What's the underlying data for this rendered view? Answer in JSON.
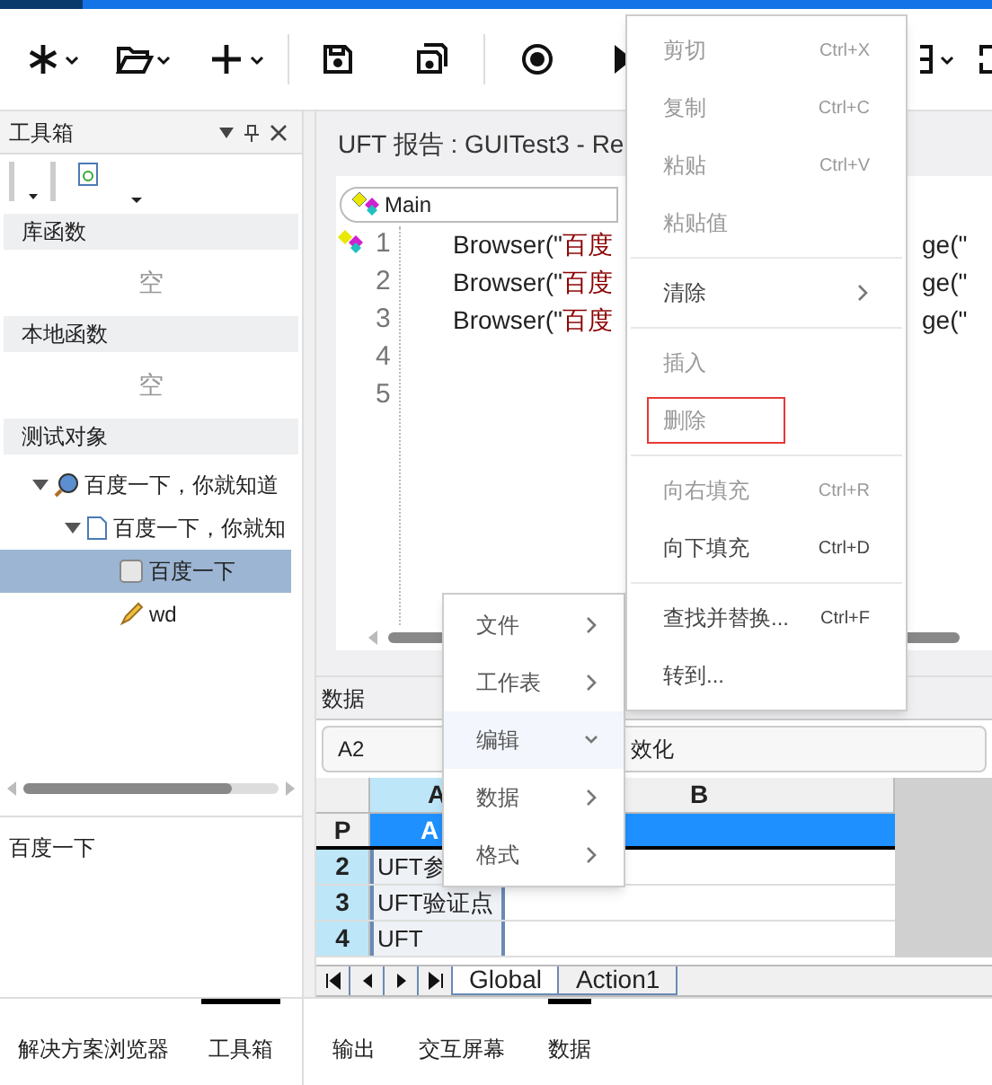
{
  "left_panel": {
    "title": "工具箱",
    "sections": [
      {
        "title": "库函数",
        "empty_text": "空"
      },
      {
        "title": "本地函数",
        "empty_text": "空"
      }
    ],
    "objects": {
      "title": "测试对象",
      "tree": [
        {
          "label": "百度一下，你就知道",
          "kind": "browser",
          "expanded": true,
          "selected": false,
          "children": [
            {
              "label": "百度一下，你就知",
              "kind": "page",
              "expanded": true,
              "selected": false,
              "children": [
                {
                  "label": "百度一下",
                  "kind": "button",
                  "selected": true
                },
                {
                  "label": "wd",
                  "kind": "edit",
                  "selected": false
                }
              ]
            }
          ]
        }
      ]
    },
    "description": "百度一下",
    "bottom_tabs": [
      {
        "label": "解决方案浏览器",
        "selected": false
      },
      {
        "label": "工具箱",
        "selected": true
      }
    ]
  },
  "editor": {
    "tab_title": "UFT 报告 : GUITest3 - Re",
    "scope": "Main",
    "lines": [
      {
        "number": "1",
        "code": "Browser(\"",
        "string": "百度",
        "code_2": "ge(\""
      },
      {
        "number": "2",
        "code": "Browser(\"",
        "string": "百度",
        "code_2": "ge(\""
      },
      {
        "number": "3",
        "code": "Browser(\"",
        "string": "百度",
        "code_2": "ge(\""
      },
      {
        "number": "4"
      },
      {
        "number": "5"
      }
    ]
  },
  "data_panel": {
    "title": "数据",
    "cell_ref": "A2",
    "formula": "效化",
    "columns": [
      {
        "label": "A",
        "selected": true
      },
      {
        "label": "B",
        "selected": false
      }
    ],
    "param_row": {
      "label": "P",
      "cell": "A"
    },
    "rows": [
      {
        "label": "2",
        "value": "UFT参"
      },
      {
        "label": "3",
        "value": "UFT验证点"
      },
      {
        "label": "4",
        "value": "UFT"
      }
    ],
    "sheets": [
      {
        "label": "Global",
        "selected": true
      },
      {
        "label": "Action1",
        "selected": false
      }
    ]
  },
  "output_tabs": [
    {
      "label": "输出",
      "selected": false
    },
    {
      "label": "交互屏幕",
      "selected": false
    },
    {
      "label": "数据",
      "selected": true
    }
  ],
  "context_menu": [
    {
      "label": "文件",
      "selected": false
    },
    {
      "label": "工作表",
      "selected": false
    },
    {
      "label": "编辑",
      "selected": true
    },
    {
      "label": "数据",
      "selected": false
    },
    {
      "label": "格式",
      "selected": false
    }
  ],
  "edit_submenu": [
    {
      "kind": "item",
      "label": "剪切",
      "shortcut": "Ctrl+X",
      "disabled": true
    },
    {
      "kind": "item",
      "label": "复制",
      "shortcut": "Ctrl+C",
      "disabled": true
    },
    {
      "kind": "item",
      "label": "粘贴",
      "shortcut": "Ctrl+V",
      "disabled": true
    },
    {
      "kind": "item",
      "label": "粘贴值",
      "disabled": true
    },
    {
      "kind": "separator"
    },
    {
      "kind": "submenu",
      "label": "清除",
      "disabled": false
    },
    {
      "kind": "separator"
    },
    {
      "kind": "item",
      "label": "插入",
      "disabled": true
    },
    {
      "kind": "item",
      "label": "删除",
      "disabled": true,
      "outlined": true
    },
    {
      "kind": "separator"
    },
    {
      "kind": "item",
      "label": "向右填充",
      "shortcut": "Ctrl+R",
      "disabled": true
    },
    {
      "kind": "item",
      "label": "向下填充",
      "shortcut": "Ctrl+D",
      "disabled": false
    },
    {
      "kind": "separator"
    },
    {
      "kind": "item",
      "label": "查找并替换...",
      "shortcut": "Ctrl+F",
      "disabled": false
    },
    {
      "kind": "item",
      "label": "转到...",
      "disabled": false
    }
  ]
}
